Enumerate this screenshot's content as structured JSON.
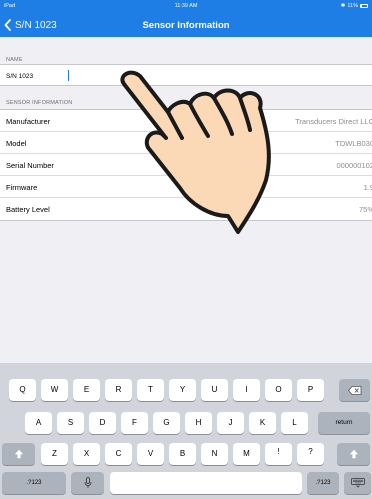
{
  "status_bar": {
    "device": "iPad",
    "time": "11:39 AM",
    "battery": "11%"
  },
  "nav": {
    "back_label": "S/N 1023",
    "title": "Sensor Information"
  },
  "name_section": {
    "header": "NAME",
    "value": "S/N 1023"
  },
  "sensor_section": {
    "header": "SENSOR INFORMATION",
    "rows": [
      {
        "label": "Manufacturer",
        "value": "Transducers Direct LLC"
      },
      {
        "label": "Model",
        "value": "TDWLB030"
      },
      {
        "label": "Serial Number",
        "value": "000000102"
      },
      {
        "label": "Firmware",
        "value": "1.9"
      },
      {
        "label": "Battery Level",
        "value": "75%"
      }
    ]
  },
  "keyboard": {
    "row1": [
      "Q",
      "W",
      "E",
      "R",
      "T",
      "Y",
      "U",
      "I",
      "O",
      "P"
    ],
    "row2": [
      "A",
      "S",
      "D",
      "F",
      "G",
      "H",
      "J",
      "K",
      "L"
    ],
    "row3": [
      "Z",
      "X",
      "C",
      "V",
      "B",
      "N",
      "M",
      "!",
      "?"
    ],
    "return_label": "return",
    "numbers_label": ".?123",
    "comma_sub": ",",
    "period_sub": "."
  },
  "colors": {
    "accent": "#1f7de6",
    "background": "#efeff4",
    "keyboard": "#d1d5db"
  },
  "icons": {
    "back": "chevron-left-icon",
    "delete": "backspace-icon",
    "shift": "shift-icon",
    "mic": "microphone-icon",
    "hide_keyboard": "keyboard-dismiss-icon",
    "overlay": "pointing-hand-icon"
  }
}
